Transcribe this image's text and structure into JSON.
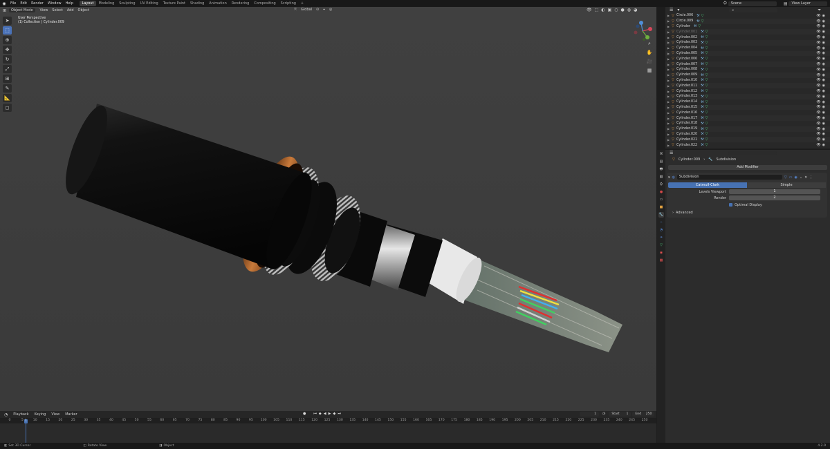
{
  "menu": [
    "File",
    "Edit",
    "Render",
    "Window",
    "Help"
  ],
  "workspaces": [
    "Layout",
    "Modeling",
    "Sculpting",
    "UV Editing",
    "Texture Paint",
    "Shading",
    "Animation",
    "Rendering",
    "Compositing",
    "Scripting",
    "+"
  ],
  "active_workspace": "Layout",
  "scene": "Scene",
  "view_layer": "View Layer",
  "viewport": {
    "mode": "Object Mode",
    "menus": [
      "View",
      "Select",
      "Add",
      "Object"
    ],
    "orientation": "Global",
    "info_line1": "User Perspective",
    "info_line2": "(1) Collection | Cylinder.009"
  },
  "outliner": {
    "search_placeholder": "",
    "items": [
      {
        "name": "Circle.006",
        "dim": false
      },
      {
        "name": "Circle.009",
        "dim": false
      },
      {
        "name": "Cylinder",
        "dim": false
      },
      {
        "name": "Cylinder.001",
        "dim": true
      },
      {
        "name": "Cylinder.002",
        "dim": false
      },
      {
        "name": "Cylinder.003",
        "dim": false
      },
      {
        "name": "Cylinder.004",
        "dim": false
      },
      {
        "name": "Cylinder.005",
        "dim": false
      },
      {
        "name": "Cylinder.006",
        "dim": false
      },
      {
        "name": "Cylinder.007",
        "dim": false
      },
      {
        "name": "Cylinder.008",
        "dim": false
      },
      {
        "name": "Cylinder.009",
        "dim": false
      },
      {
        "name": "Cylinder.010",
        "dim": false
      },
      {
        "name": "Cylinder.011",
        "dim": false
      },
      {
        "name": "Cylinder.012",
        "dim": false
      },
      {
        "name": "Cylinder.013",
        "dim": false
      },
      {
        "name": "Cylinder.014",
        "dim": false
      },
      {
        "name": "Cylinder.015",
        "dim": false
      },
      {
        "name": "Cylinder.016",
        "dim": false
      },
      {
        "name": "Cylinder.017",
        "dim": false
      },
      {
        "name": "Cylinder.018",
        "dim": false
      },
      {
        "name": "Cylinder.019",
        "dim": false
      },
      {
        "name": "Cylinder.020",
        "dim": false
      },
      {
        "name": "Cylinder.021",
        "dim": false
      },
      {
        "name": "Cylinder.022",
        "dim": false
      }
    ]
  },
  "properties": {
    "object": "Cylinder.009",
    "modifier_label": "Subdivision",
    "add_modifier": "Add Modifier",
    "modifier_name": "Subdivision",
    "tab_catmull": "Catmull-Clark",
    "tab_simple": "Simple",
    "levels_viewport_label": "Levels Viewport",
    "levels_viewport": "1",
    "render_label": "Render",
    "render": "2",
    "optimal_display": "Optimal Display",
    "advanced": "Advanced"
  },
  "timeline": {
    "menus": [
      "Playback",
      "Keying",
      "View",
      "Marker"
    ],
    "current_frame": "1",
    "start_label": "Start",
    "start": "1",
    "end_label": "End",
    "end": "250",
    "ticks": [
      "0",
      "5",
      "10",
      "15",
      "20",
      "25",
      "30",
      "35",
      "40",
      "45",
      "50",
      "55",
      "60",
      "65",
      "70",
      "75",
      "80",
      "85",
      "90",
      "95",
      "100",
      "105",
      "110",
      "115",
      "120",
      "125",
      "130",
      "135",
      "140",
      "145",
      "150",
      "155",
      "160",
      "165",
      "170",
      "175",
      "180",
      "185",
      "190",
      "195",
      "200",
      "205",
      "210",
      "215",
      "220",
      "225",
      "230",
      "235",
      "240",
      "245",
      "250"
    ],
    "cursor_label": "1"
  },
  "status": {
    "left": "Set 3D Cursor",
    "middle": "Rotate View",
    "right": "Object",
    "version": "4.2.0"
  },
  "colors": {
    "accent": "#4772b3",
    "object_icon": "#e09a4a"
  }
}
